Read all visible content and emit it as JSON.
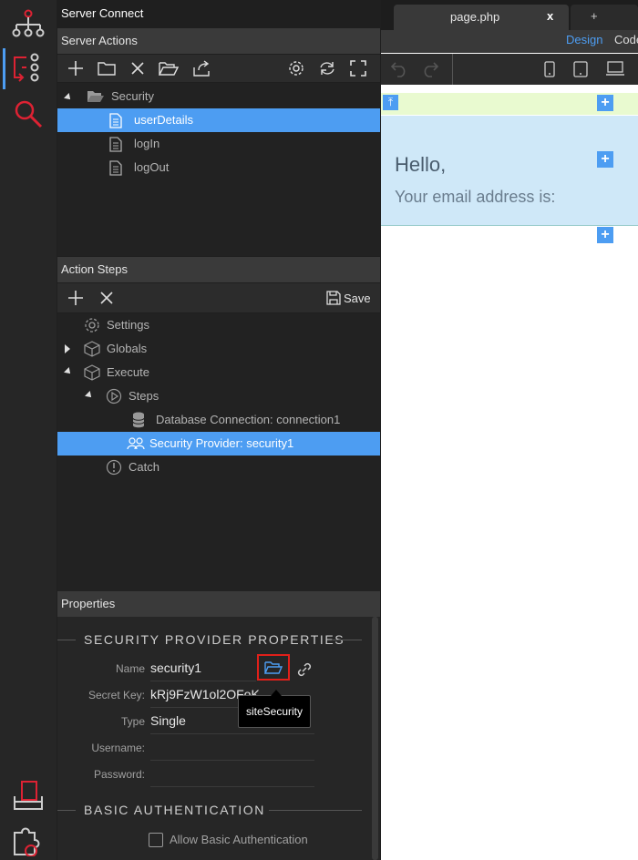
{
  "server_connect": {
    "title": "Server Connect"
  },
  "server_actions": {
    "title": "Server Actions",
    "toolbar": [
      "add-icon",
      "folder-icon",
      "delete-icon",
      "folder-open-icon",
      "export-icon",
      "settings-icon",
      "refresh-icon",
      "expand-icon"
    ],
    "tree": [
      {
        "label": "Security",
        "level": 0,
        "type": "folder",
        "expanded": true,
        "selected": false
      },
      {
        "label": "userDetails",
        "level": 1,
        "type": "file",
        "selected": true
      },
      {
        "label": "logIn",
        "level": 1,
        "type": "file",
        "selected": false
      },
      {
        "label": "logOut",
        "level": 1,
        "type": "file",
        "selected": false
      }
    ]
  },
  "action_steps": {
    "title": "Action Steps",
    "save_label": "Save",
    "tree": [
      {
        "label": "Settings",
        "icon": "gear-icon"
      },
      {
        "label": "Globals",
        "icon": "cube-icon"
      },
      {
        "label": "Execute",
        "icon": "cube-icon"
      },
      {
        "label": "Steps",
        "icon": "play-circle-icon"
      },
      {
        "label": "Database Connection: connection1",
        "icon": "database-icon"
      },
      {
        "label": "Security Provider: security1",
        "icon": "users-icon",
        "selected": true
      },
      {
        "label": "Catch",
        "icon": "alert-circle-icon"
      }
    ]
  },
  "properties": {
    "title": "Properties",
    "section_title": "SECURITY PROVIDER PROPERTIES",
    "fields": {
      "name": {
        "label": "Name",
        "value": "security1"
      },
      "secret_key": {
        "label": "Secret Key:",
        "value": "kRj9FzW1ol2OFoK"
      },
      "type": {
        "label": "Type",
        "value": "Single"
      },
      "username": {
        "label": "Username:",
        "value": ""
      },
      "password": {
        "label": "Password:",
        "value": ""
      }
    },
    "tooltip": "siteSecurity",
    "basic_auth": {
      "title": "BASIC AUTHENTICATION",
      "checkbox_label": "Allow Basic Authentication",
      "checked": false
    }
  },
  "editor": {
    "tab_label": "page.php",
    "tab_close": "x",
    "new_tab": "+",
    "mode_design": "Design",
    "mode_code": "Code",
    "canvas": {
      "heading": "Hello,",
      "text": "Your email address is:"
    }
  },
  "colors": {
    "accent": "#4d9df2",
    "highlight_red": "#e0201a",
    "canvas_blue": "#cfe8f8",
    "canvas_green": "#e9fad0"
  }
}
